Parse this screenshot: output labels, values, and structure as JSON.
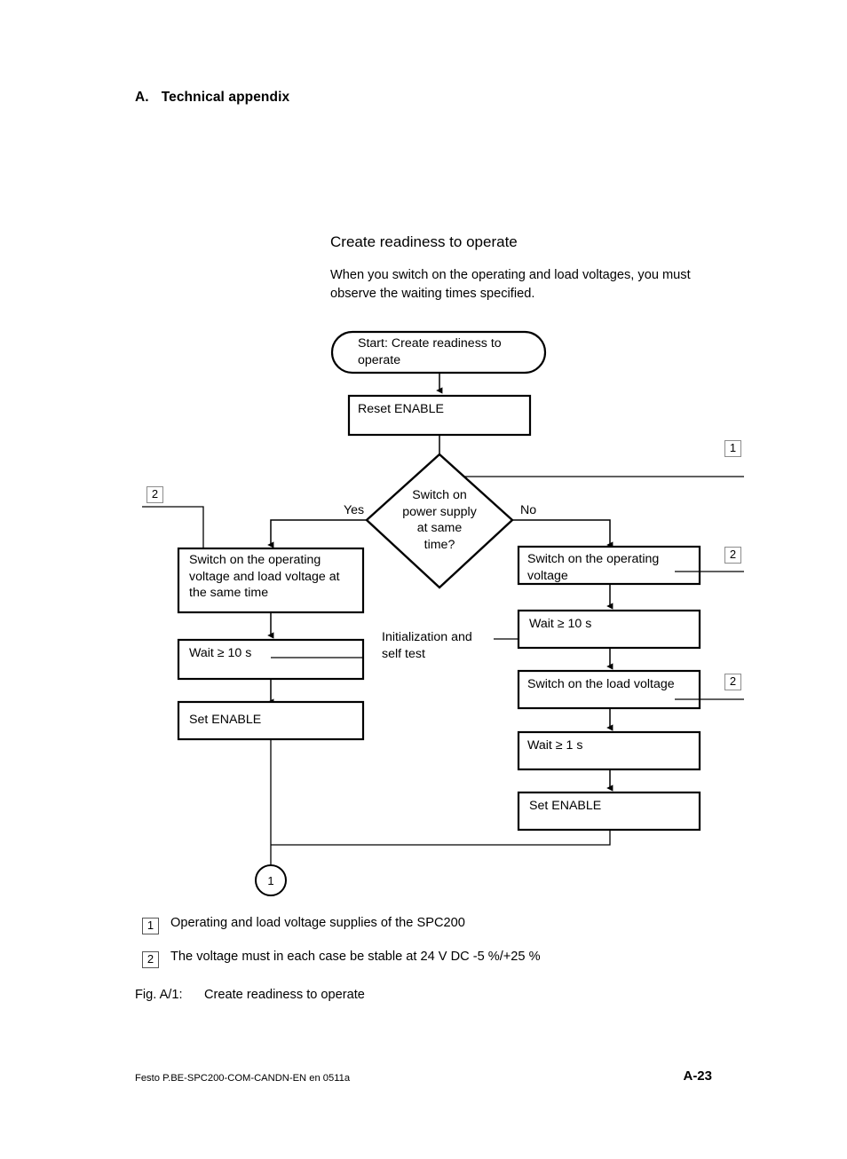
{
  "page": {
    "chapter_letter": "A.",
    "chapter_title": "Technical appendix",
    "section_title": "Create readiness to operate",
    "intro_text": "When you switch on the operating and load voltages, you must observe the waiting times specified.",
    "figure_caption_label": "Fig. A/1:",
    "figure_caption_text": "Create readiness to operate",
    "footer_left": "Festo P.BE-SPC200-COM-CANDN-EN  en 0511a",
    "footer_right": "A-23"
  },
  "flowchart": {
    "start": "Start: Create readiness to operate",
    "reset_enable": "Reset ENABLE",
    "decision": "Switch on\npower supply\nat same\ntime?",
    "branch_yes_label": "Yes",
    "branch_no_label": "No",
    "annotation": "Initialization and\nself test",
    "connector_circle": "1",
    "left_branch": [
      "Switch on the operating voltage and load voltage at the same time",
      "Wait ≥ 10 s",
      "Set ENABLE"
    ],
    "right_branch": [
      "Switch on the operating voltage",
      "Wait ≥ 10 s",
      "Switch on the load voltage",
      "Wait ≥ 1 s",
      "Set ENABLE"
    ],
    "callouts": {
      "decision_right": "1",
      "left_upper": "2",
      "right_operating_voltage": "2",
      "right_load_voltage": "2"
    }
  },
  "legend": [
    {
      "num": "1",
      "text": "Operating and load voltage supplies of the SPC200"
    },
    {
      "num": "2",
      "text": "The voltage must in each case be stable at 24 V DC -5 %/+25 %"
    }
  ],
  "colors": {
    "ink": "#000000",
    "paper": "#ffffff",
    "callout_border": "#8c8c8c"
  }
}
